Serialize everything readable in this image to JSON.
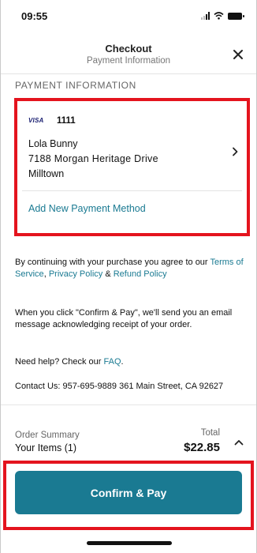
{
  "status_bar": {
    "time": "09:55"
  },
  "header": {
    "title": "Checkout",
    "subtitle": "Payment Information"
  },
  "section_label": "PAYMENT INFORMATION",
  "payment_method": {
    "brand": "VISA",
    "last4": "1111",
    "name": "Lola Bunny",
    "street": "7188 Morgan Heritage Drive",
    "city": "Milltown"
  },
  "add_payment_label": "Add New Payment Method",
  "legal": {
    "terms_prefix": "By continuing with your purchase you agree to our ",
    "terms_link": "Terms of Service",
    "terms_sep1": ", ",
    "privacy_link": "Privacy Policy",
    "terms_sep2": " & ",
    "refund_link": "Refund Policy",
    "email_notice": "When you click \"Confirm & Pay\", we'll send you an email message acknowledging receipt of your order.",
    "help_prefix": "Need help? Check our ",
    "faq_link": "FAQ",
    "help_suffix": ".",
    "contact": "Contact Us: 957-695-9889 361 Main Street, CA 92627"
  },
  "summary": {
    "label": "Order Summary",
    "items": "Your Items (1)",
    "total_label": "Total",
    "total_value": "$22.85"
  },
  "confirm_label": "Confirm & Pay",
  "colors": {
    "accent": "#1a7a92",
    "highlight": "#e4141e",
    "visa_blue": "#1a1f71"
  }
}
